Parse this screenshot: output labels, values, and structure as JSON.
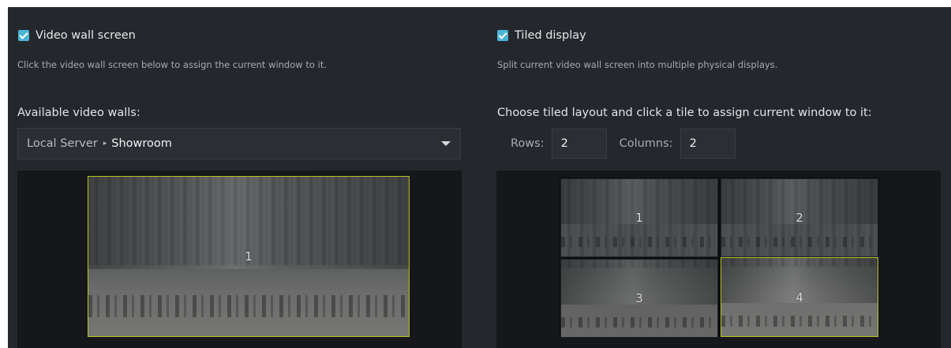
{
  "video_wall": {
    "enabled": true,
    "label": "Video wall screen",
    "hint": "Click the video wall screen below to assign the current window to it.",
    "available_label": "Available video walls:",
    "selection": {
      "server": "Local Server",
      "separator": "▸",
      "wall": "Showroom"
    },
    "screen_number": "1"
  },
  "tiled_display": {
    "enabled": true,
    "label": "Tiled display",
    "hint": "Split current video wall screen into multiple physical displays.",
    "layout_label": "Choose tiled layout and click a tile to assign current window to it:",
    "rows_label": "Rows:",
    "rows_value": "2",
    "columns_label": "Columns:",
    "columns_value": "2",
    "tiles": [
      "1",
      "2",
      "3",
      "4"
    ],
    "selected_tile": "4"
  },
  "colors": {
    "background": "#24272c",
    "checkbox": "#4bb4d8",
    "selection_border": "#b7c221"
  },
  "icons": {
    "checkbox": "checkmark-icon",
    "dropdown": "caret-down-icon",
    "breadcrumb": "triangle-right-icon"
  }
}
